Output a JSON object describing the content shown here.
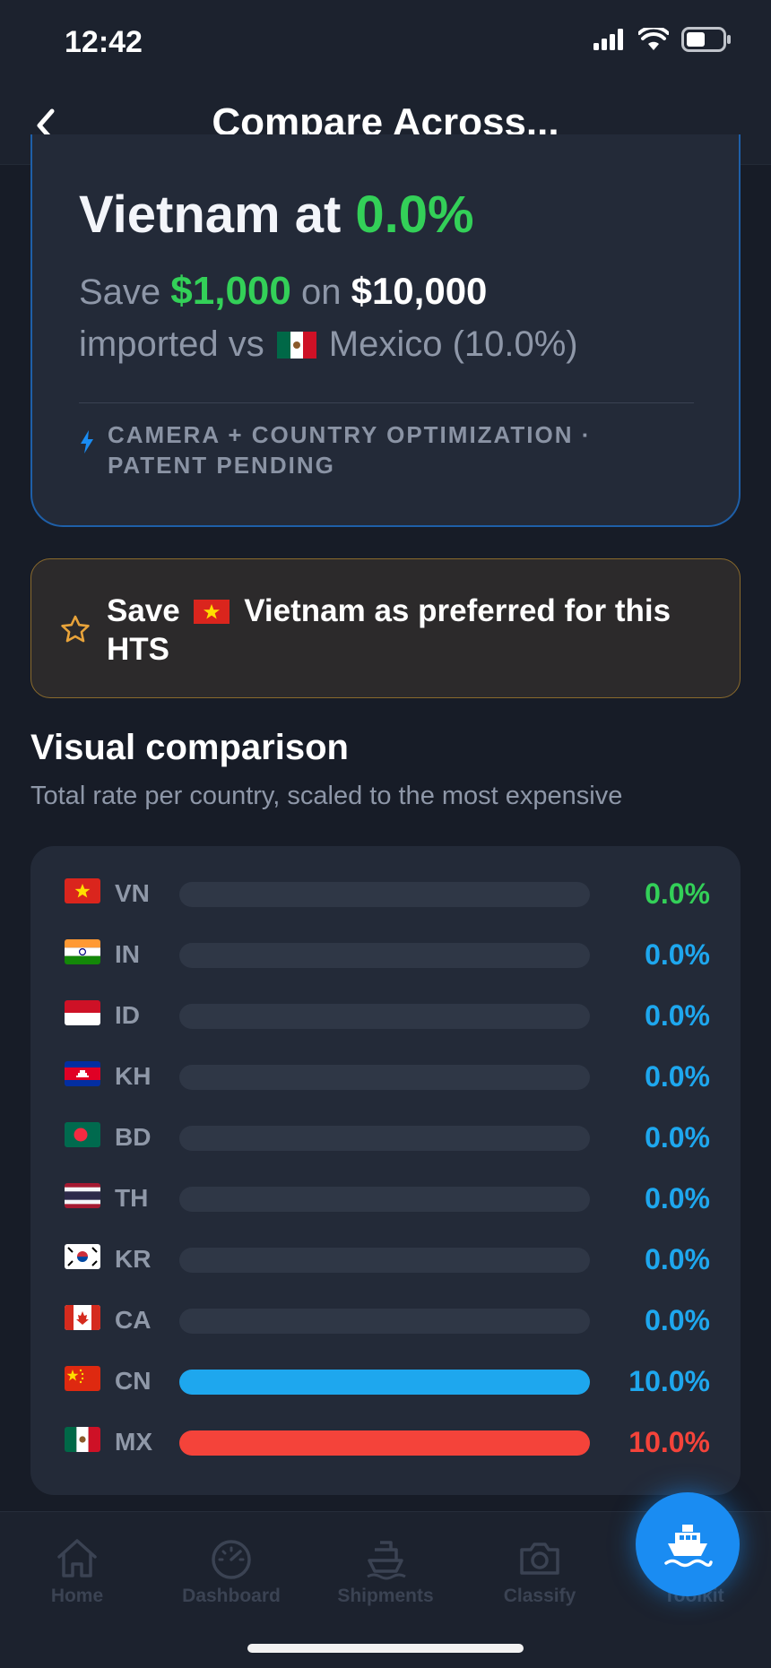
{
  "status_bar": {
    "time": "12:42"
  },
  "nav": {
    "title": "Compare Across..."
  },
  "hero": {
    "title_country": "Vietnam at ",
    "title_rate": "0.0%",
    "save_prefix": "Save ",
    "save_amount": "$1,000",
    "save_on": " on ",
    "save_base": "$10,000",
    "compare_prefix": "imported vs",
    "compare_country": "Mexico (10.0%)",
    "note": "CAMERA + COUNTRY OPTIMIZATION · PATENT PENDING"
  },
  "save_preferred": {
    "prefix": "Save",
    "country": "Vietnam as preferred for this HTS"
  },
  "visual": {
    "title": "Visual comparison",
    "subtitle": "Total rate per country, scaled to the most expensive"
  },
  "rows": [
    {
      "code": "VN",
      "value": "0.0%",
      "fill_fraction": 0.0,
      "color": "#33d058"
    },
    {
      "code": "IN",
      "value": "0.0%",
      "fill_fraction": 0.0,
      "color": "#1ea7ee"
    },
    {
      "code": "ID",
      "value": "0.0%",
      "fill_fraction": 0.0,
      "color": "#1ea7ee"
    },
    {
      "code": "KH",
      "value": "0.0%",
      "fill_fraction": 0.0,
      "color": "#1ea7ee"
    },
    {
      "code": "BD",
      "value": "0.0%",
      "fill_fraction": 0.0,
      "color": "#1ea7ee"
    },
    {
      "code": "TH",
      "value": "0.0%",
      "fill_fraction": 0.0,
      "color": "#1ea7ee"
    },
    {
      "code": "KR",
      "value": "0.0%",
      "fill_fraction": 0.0,
      "color": "#1ea7ee"
    },
    {
      "code": "CA",
      "value": "0.0%",
      "fill_fraction": 0.0,
      "color": "#1ea7ee"
    },
    {
      "code": "CN",
      "value": "10.0%",
      "fill_fraction": 1.0,
      "color": "#1ea7ee"
    },
    {
      "code": "MX",
      "value": "10.0%",
      "fill_fraction": 1.0,
      "color": "#f4433a"
    }
  ],
  "tabs": [
    {
      "label": "Home",
      "icon": "home-icon"
    },
    {
      "label": "Dashboard",
      "icon": "gauge-icon"
    },
    {
      "label": "Shipments",
      "icon": "ship-icon"
    },
    {
      "label": "Classify",
      "icon": "camera-icon"
    },
    {
      "label": "Toolkit",
      "icon": "toolkit-icon"
    }
  ],
  "fab": {
    "icon": "ship-icon"
  },
  "colors": {
    "accent_green": "#33d058",
    "accent_blue": "#1ea7ee",
    "accent_red": "#f4433a",
    "fab_blue": "#1a8cf2",
    "card_border_blue": "#1e5fa8",
    "gold_border": "#8a6a2c"
  }
}
